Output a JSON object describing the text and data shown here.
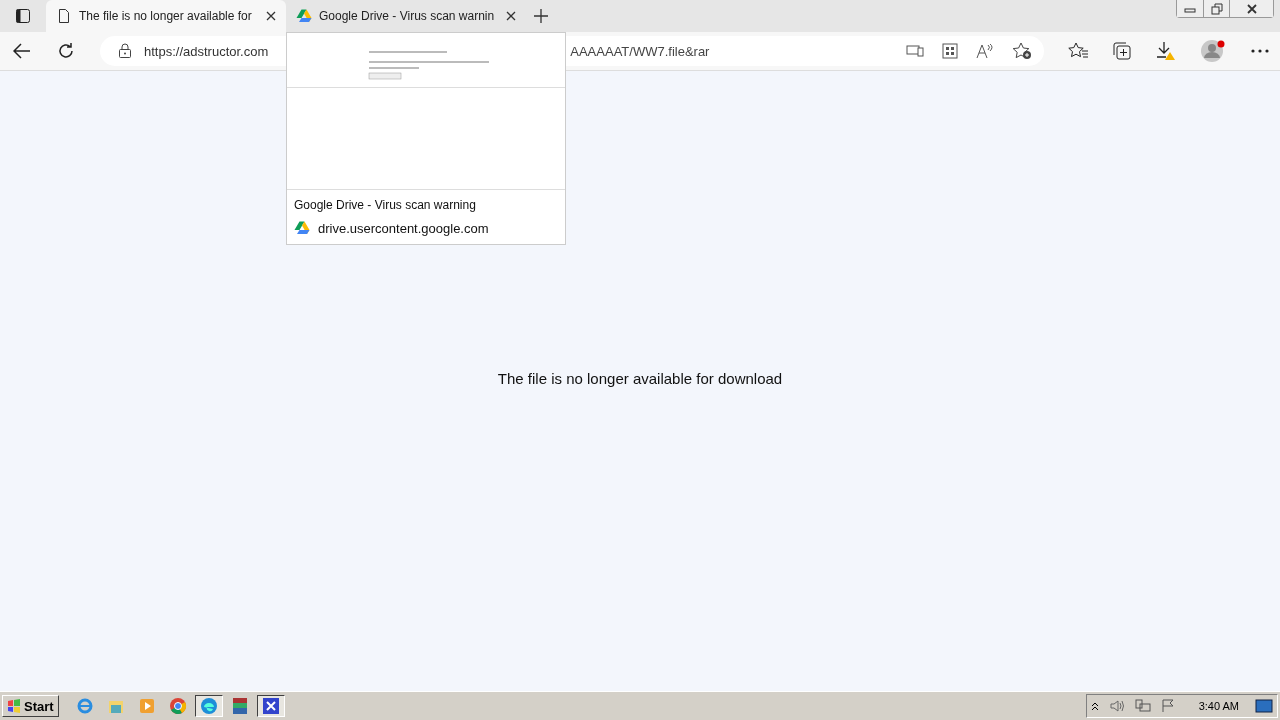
{
  "tabs": [
    {
      "title": "The file is no longer available for",
      "selected": true
    },
    {
      "title": "Google Drive - Virus scan warnin",
      "selected": false
    }
  ],
  "address": {
    "url_start": "https://adstructor.com",
    "url_end": "AAAAAAT/WW7.file&rar"
  },
  "tab_preview": {
    "title": "Google Drive - Virus scan warning",
    "domain": "drive.usercontent.google.com"
  },
  "page": {
    "message": "The file is no longer available for download"
  },
  "taskbar": {
    "start": "Start",
    "clock": "3:40 AM",
    "apps": [
      {
        "kind": "ie",
        "selected": false
      },
      {
        "kind": "folder",
        "selected": false
      },
      {
        "kind": "media",
        "selected": false
      },
      {
        "kind": "chrome",
        "selected": false
      },
      {
        "kind": "edge",
        "selected": true
      },
      {
        "kind": "rar",
        "selected": false
      },
      {
        "kind": "app",
        "selected": true
      }
    ]
  }
}
